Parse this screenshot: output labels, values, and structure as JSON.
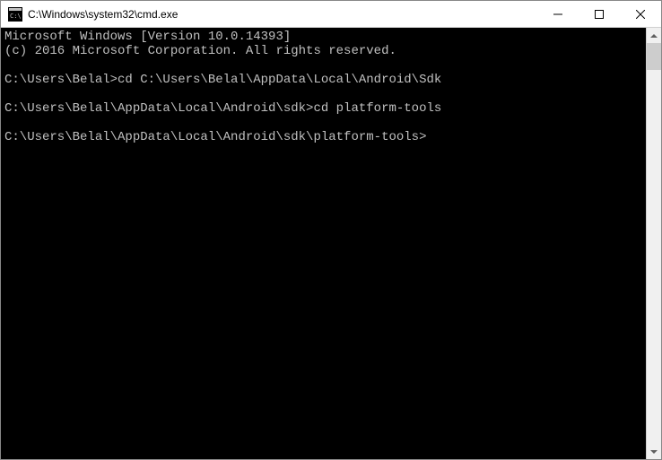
{
  "window": {
    "title": "C:\\Windows\\system32\\cmd.exe"
  },
  "terminal": {
    "lines": [
      "Microsoft Windows [Version 10.0.14393]",
      "(c) 2016 Microsoft Corporation. All rights reserved.",
      "",
      "C:\\Users\\Belal>cd C:\\Users\\Belal\\AppData\\Local\\Android\\Sdk",
      "",
      "C:\\Users\\Belal\\AppData\\Local\\Android\\sdk>cd platform-tools",
      "",
      "C:\\Users\\Belal\\AppData\\Local\\Android\\sdk\\platform-tools>"
    ]
  }
}
